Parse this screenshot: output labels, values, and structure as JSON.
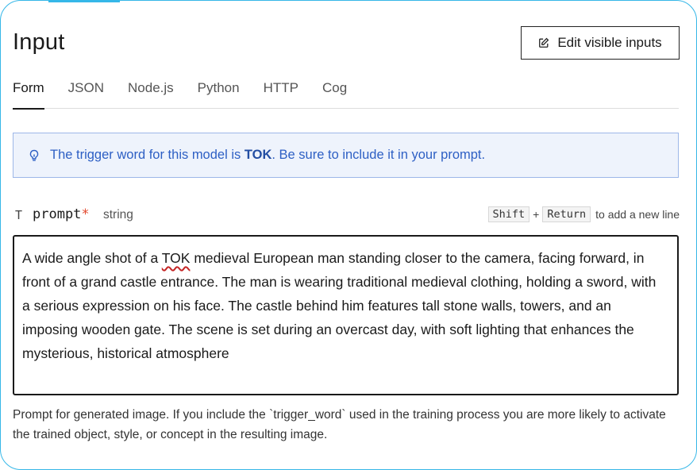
{
  "header": {
    "title": "Input",
    "edit_label": "Edit visible inputs"
  },
  "tabs": [
    {
      "label": "Form",
      "active": true
    },
    {
      "label": "JSON"
    },
    {
      "label": "Node.js"
    },
    {
      "label": "Python"
    },
    {
      "label": "HTTP"
    },
    {
      "label": "Cog"
    }
  ],
  "notice": {
    "prefix": "The trigger word for this model is ",
    "word": "TOK",
    "suffix": ". Be sure to include it in your prompt."
  },
  "field": {
    "icon_glyph": "T",
    "name": "prompt",
    "required_mark": "*",
    "type": "string",
    "hint_key1": "Shift",
    "hint_plus": "+",
    "hint_key2": "Return",
    "hint_text": "to add a new line",
    "value_pre": "A wide angle shot of a ",
    "value_word": "TOK",
    "value_post": " medieval European man standing closer to the camera, facing forward, in front of a grand castle entrance. The man is wearing traditional medieval clothing, holding a sword, with a serious expression on his face. The castle behind him features tall stone walls, towers, and an imposing wooden gate. The scene is set during an overcast day, with soft lighting that enhances the mysterious, historical atmosphere",
    "description": "Prompt for generated image. If you include the `trigger_word` used in the training process you are more likely to activate the trained object, style, or concept in the resulting image."
  },
  "colors": {
    "frame": "#35b7e8",
    "notice_text": "#2d5fc4",
    "required": "#e2492f",
    "spell_underline": "#c52525"
  },
  "icons": {
    "edit": "pencil-square-icon",
    "notice": "lightbulb-icon",
    "field_type": "text-type-icon"
  }
}
